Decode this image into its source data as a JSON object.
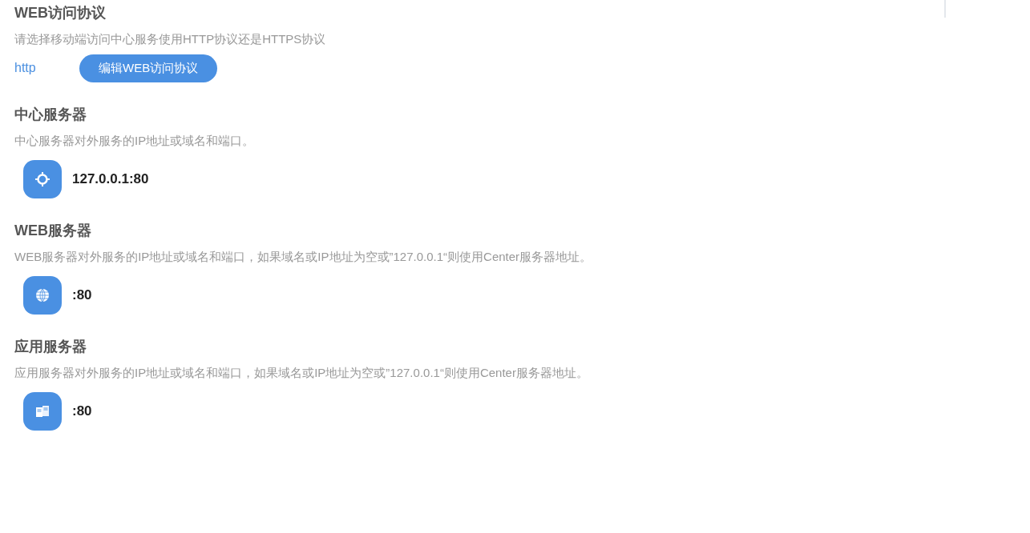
{
  "sections": [
    {
      "kind": "protocol",
      "title": "WEB访问协议",
      "description": "请选择移动端访问中心服务使用HTTP协议还是HTTPS协议",
      "value": "http",
      "button": "编辑WEB访问协议"
    },
    {
      "kind": "address",
      "title": "中心服务器",
      "description": "中心服务器对外服务的IP地址或域名和端口。",
      "value": "127.0.0.1:80"
    },
    {
      "kind": "address",
      "title": "WEB服务器",
      "description": "WEB服务器对外服务的IP地址或域名和端口，如果域名或IP地址为空或”127.0.0.1“则使用Center服务器地址。",
      "value": ":80"
    },
    {
      "kind": "address",
      "title": "应用服务器",
      "description": "应用服务器对外服务的IP地址或域名和端口，如果域名或IP地址为空或”127.0.0.1“则使用Center服务器地址。",
      "value": ":80"
    }
  ]
}
